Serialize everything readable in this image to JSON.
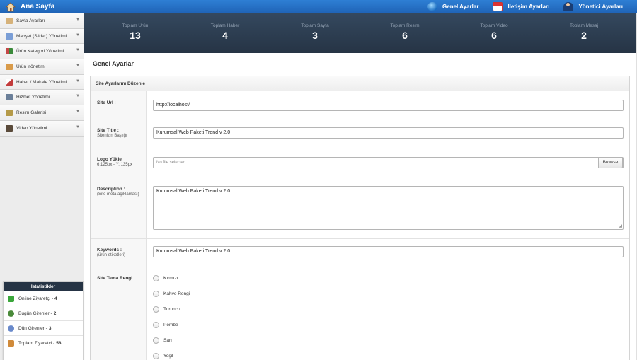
{
  "brand": {
    "title": "Ana Sayfa",
    "icon": "house-icon"
  },
  "topnav": [
    {
      "label": "Genel Ayarlar",
      "icon": "globe-icon"
    },
    {
      "label": "İletişim Ayarları",
      "icon": "calendar-icon"
    },
    {
      "label": "Yönetici Ayarları",
      "icon": "user-icon"
    }
  ],
  "sidebar": {
    "items": [
      {
        "label": "Sayfa Ayarları",
        "icon": "pages-icon",
        "color": "#d6b27a"
      },
      {
        "label": "Manşet (Slider) Yönetimi",
        "icon": "slider-icon",
        "color": "#7a9ed6"
      },
      {
        "label": "Ürün Kategori Yönetimi",
        "icon": "category-icon",
        "color": "#c44848"
      },
      {
        "label": "Ürün Yönetimi",
        "icon": "product-icon",
        "color": "#d99b4a"
      },
      {
        "label": "Haber / Makale Yönetimi",
        "icon": "news-icon",
        "color": "#c33b3b"
      },
      {
        "label": "Hizmet Yönetimi",
        "icon": "service-icon",
        "color": "#6b7f99"
      },
      {
        "label": "Resim Galerisi",
        "icon": "gallery-icon",
        "color": "#b59a48"
      },
      {
        "label": "Video Yönetimi",
        "icon": "video-icon",
        "color": "#5a4a3a"
      }
    ],
    "arrow": "▼"
  },
  "stats": {
    "title": "İstatistikler",
    "rows": [
      {
        "label": "Online Ziyaretçi -",
        "value": "4",
        "icon": "online-icon",
        "color": "#3aa63a"
      },
      {
        "label": "Bugün Girenler -",
        "value": "2",
        "icon": "users-today-icon",
        "color": "#4a8a3a"
      },
      {
        "label": "Dün Girenler -",
        "value": "3",
        "icon": "users-yesterday-icon",
        "color": "#6a8acb"
      },
      {
        "label": "Toplam Ziyaretçi -",
        "value": "58",
        "icon": "home-stats-icon",
        "color": "#d08a3a"
      }
    ]
  },
  "summary": [
    {
      "label": "Toplam Ürün",
      "value": "13"
    },
    {
      "label": "Toplam Haber",
      "value": "4"
    },
    {
      "label": "Toplam Sayfa",
      "value": "3"
    },
    {
      "label": "Toplam Resim",
      "value": "6"
    },
    {
      "label": "Toplam Video",
      "value": "6"
    },
    {
      "label": "Toplam Mesaj",
      "value": "2"
    }
  ],
  "page": {
    "title": "Genel Ayarlar"
  },
  "form": {
    "panel_title": "Site Ayarlarını Düzenle",
    "site_url": {
      "label": "Site Url :",
      "value": "http://localhost/"
    },
    "site_title": {
      "label": "Site Title :",
      "hint": "Sitenizin Başlığı",
      "value": "Kurumsal Web Paketi Trend v 2.0"
    },
    "logo": {
      "label": "Logo Yükle",
      "hint": "6:125px - Y: 135px",
      "placeholder": "No file selected...",
      "button": "Browse"
    },
    "description": {
      "label": "Description :",
      "hint": "(Site meta açıklaması)",
      "value": "Kurumsal Web Paketi Trend v 2.0"
    },
    "keywords": {
      "label": "Keywords :",
      "hint": "(ürün etiketleri)",
      "value": "Kurumsal Web Paketi Trend v 2.0"
    },
    "theme": {
      "label": "Site Tema Rengi",
      "options": [
        "Kırmızı",
        "Kahve Rengi",
        "Turuncu",
        "Pembe",
        "Sarı",
        "Yeşil"
      ]
    }
  }
}
